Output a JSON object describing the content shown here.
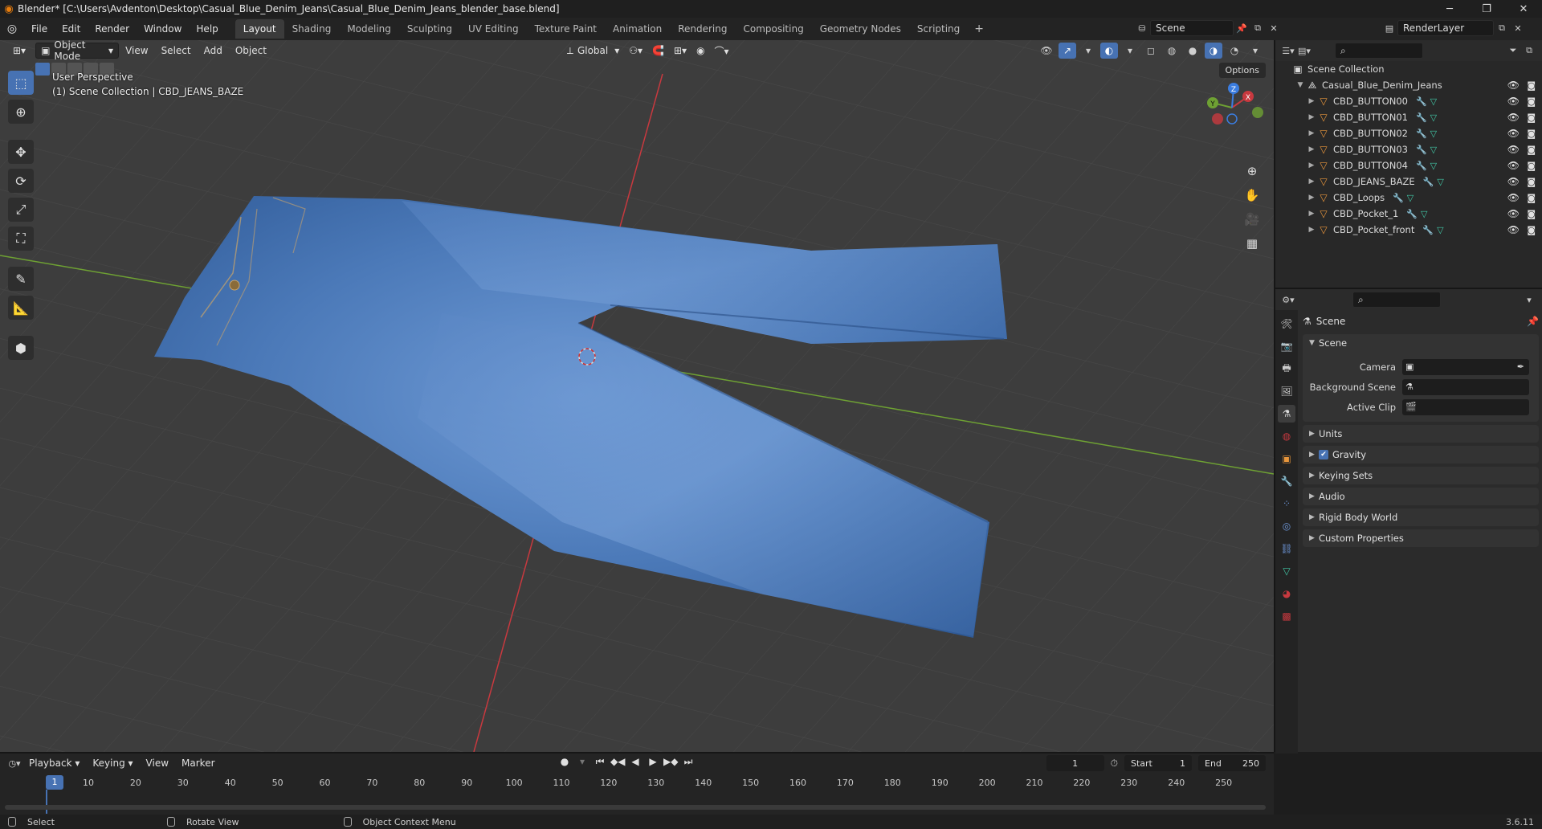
{
  "window": {
    "title": "Blender* [C:\\Users\\Avdenton\\Desktop\\Casual_Blue_Denim_Jeans\\Casual_Blue_Denim_Jeans_blender_base.blend]",
    "minimize": "─",
    "maximize": "❐",
    "close": "✕"
  },
  "menubar": {
    "items": [
      "File",
      "Edit",
      "Render",
      "Window",
      "Help"
    ],
    "workspaces": [
      "Layout",
      "Shading",
      "Modeling",
      "Sculpting",
      "UV Editing",
      "Texture Paint",
      "Animation",
      "Rendering",
      "Compositing",
      "Geometry Nodes",
      "Scripting"
    ],
    "active_workspace": "Layout",
    "add_label": "+",
    "scene": "Scene",
    "render_layer": "RenderLayer"
  },
  "viewport": {
    "mode": "Object Mode",
    "menus": [
      "View",
      "Select",
      "Add",
      "Object"
    ],
    "transform_orientation": "Global",
    "options_label": "Options",
    "perspective_label": "User Perspective",
    "collection_label": "(1) Scene Collection | CBD_JEANS_BAZE",
    "gizmo_axes": {
      "x": "X",
      "y": "Y",
      "z": "Z"
    }
  },
  "outliner": {
    "root": "Scene Collection",
    "collection": "Casual_Blue_Denim_Jeans",
    "objects": [
      "CBD_BUTTON00",
      "CBD_BUTTON01",
      "CBD_BUTTON02",
      "CBD_BUTTON03",
      "CBD_BUTTON04",
      "CBD_JEANS_BAZE",
      "CBD_Loops",
      "CBD_Pocket_1",
      "CBD_Pocket_front"
    ]
  },
  "properties": {
    "context": "Scene",
    "scene_panel": "Scene",
    "fields": [
      {
        "label": "Camera",
        "value": ""
      },
      {
        "label": "Background Scene",
        "value": ""
      },
      {
        "label": "Active Clip",
        "value": ""
      }
    ],
    "collapsed_panels": [
      "Units",
      "Gravity",
      "Keying Sets",
      "Audio",
      "Rigid Body World",
      "Custom Properties"
    ],
    "gravity_checked": true
  },
  "timeline": {
    "menus": [
      "Playback",
      "Keying",
      "View",
      "Marker"
    ],
    "current_frame": "1",
    "start_label": "Start",
    "start": "1",
    "end_label": "End",
    "end": "250",
    "ticks": [
      "1",
      "10",
      "20",
      "30",
      "40",
      "50",
      "60",
      "70",
      "80",
      "90",
      "100",
      "110",
      "120",
      "130",
      "140",
      "150",
      "160",
      "170",
      "180",
      "190",
      "200",
      "210",
      "220",
      "230",
      "240",
      "250"
    ]
  },
  "statusbar": {
    "items": [
      "Select",
      "Rotate View",
      "Object Context Menu"
    ],
    "version": "3.6.11"
  },
  "colors": {
    "accent": "#4772b3",
    "object_icon": "#e8963c",
    "x_axis": "#c8393f",
    "y_axis": "#6ea133",
    "denim": "#4b79b8"
  }
}
